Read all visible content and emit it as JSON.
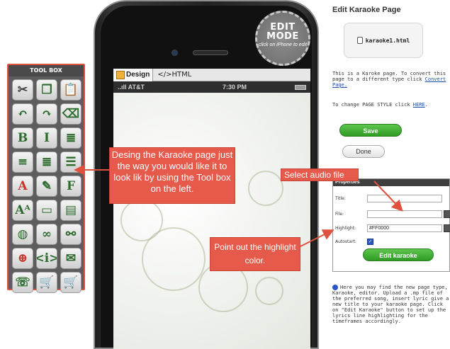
{
  "toolbox": {
    "title": "TOOL BOX",
    "tools": [
      {
        "glyph": "✂",
        "icon": "cut-icon",
        "cls": "dark"
      },
      {
        "glyph": "❐",
        "icon": "copy-icon",
        "cls": ""
      },
      {
        "glyph": "📋",
        "icon": "paste-icon",
        "cls": ""
      },
      {
        "glyph": "↶",
        "icon": "undo-icon",
        "cls": ""
      },
      {
        "glyph": "↷",
        "icon": "redo-icon",
        "cls": ""
      },
      {
        "glyph": "⌫",
        "icon": "eraser-icon",
        "cls": ""
      },
      {
        "glyph": "B",
        "icon": "bold-icon",
        "cls": ""
      },
      {
        "glyph": "I",
        "icon": "italic-icon",
        "cls": ""
      },
      {
        "glyph": "≣",
        "icon": "align-left-icon",
        "cls": ""
      },
      {
        "glyph": "≡",
        "icon": "align-center-icon",
        "cls": ""
      },
      {
        "glyph": "≣",
        "icon": "align-right-icon",
        "cls": ""
      },
      {
        "glyph": "☰",
        "icon": "justify-icon",
        "cls": ""
      },
      {
        "glyph": "A",
        "icon": "font-color-icon",
        "cls": "red"
      },
      {
        "glyph": "✎",
        "icon": "highlight-icon",
        "cls": ""
      },
      {
        "glyph": "F",
        "icon": "font-family-icon",
        "cls": ""
      },
      {
        "glyph": "Aᴬ",
        "icon": "font-size-icon",
        "cls": ""
      },
      {
        "glyph": "▭",
        "icon": "image-icon",
        "cls": ""
      },
      {
        "glyph": "▤",
        "icon": "document-link-icon",
        "cls": ""
      },
      {
        "glyph": "◍",
        "icon": "web-link-icon",
        "cls": ""
      },
      {
        "glyph": "∞",
        "icon": "link-icon",
        "cls": ""
      },
      {
        "glyph": "⚯",
        "icon": "unlink-icon",
        "cls": ""
      },
      {
        "glyph": "⊕",
        "icon": "google-map-icon",
        "cls": "red"
      },
      {
        "glyph": "<i>",
        "icon": "html-code-icon",
        "cls": ""
      },
      {
        "glyph": "✉",
        "icon": "email-link-icon",
        "cls": ""
      },
      {
        "glyph": "☏",
        "icon": "phone-link-icon",
        "cls": ""
      },
      {
        "glyph": "🛒",
        "icon": "add-to-cart-icon",
        "cls": ""
      },
      {
        "glyph": "🛒",
        "icon": "remove-from-cart-icon",
        "cls": ""
      }
    ]
  },
  "editor": {
    "tab_design": "Design",
    "tab_html": "</>HTML",
    "carrier": "..ıll AT&T",
    "time": "7:30 PM"
  },
  "edit_badge": {
    "line1": "EDIT",
    "line2": "MODE",
    "hint": "click on iPhone to edit"
  },
  "panel": {
    "title": "Edit Karaoke Page",
    "filename": "karaoke1.html",
    "info_text": "This is a Karoke page. To convert this page to a different type click",
    "convert_link": "Convert",
    "page_suffix": "Page.",
    "style_text": "To change PAGE STYLE click",
    "style_link": "HERE",
    "save_label": "Save",
    "done_label": "Done",
    "properties_title": "Properties",
    "title_label": "Title:",
    "file_label": "File:",
    "highlight_label": "Highlight:",
    "highlight_value": "#FF0000",
    "autostart_label": "Autostart:",
    "edit_karaoke_label": "Edit karaoke",
    "help_text": "Here you may find the new page type, Karaoke, editor. Upload a .mp file of the preferred song, insert lyric give a new title to your karaoke page. Click on \"Edit Karaoke\" button to set up the lyrics line highlighting for the timeframes accordingly."
  },
  "callouts": {
    "design": "Desing the Karaoke page just the way you would like it to look lik by using the Tool box on the left.",
    "audio": "Select audio file",
    "highlight": "Point out the highlight color."
  }
}
